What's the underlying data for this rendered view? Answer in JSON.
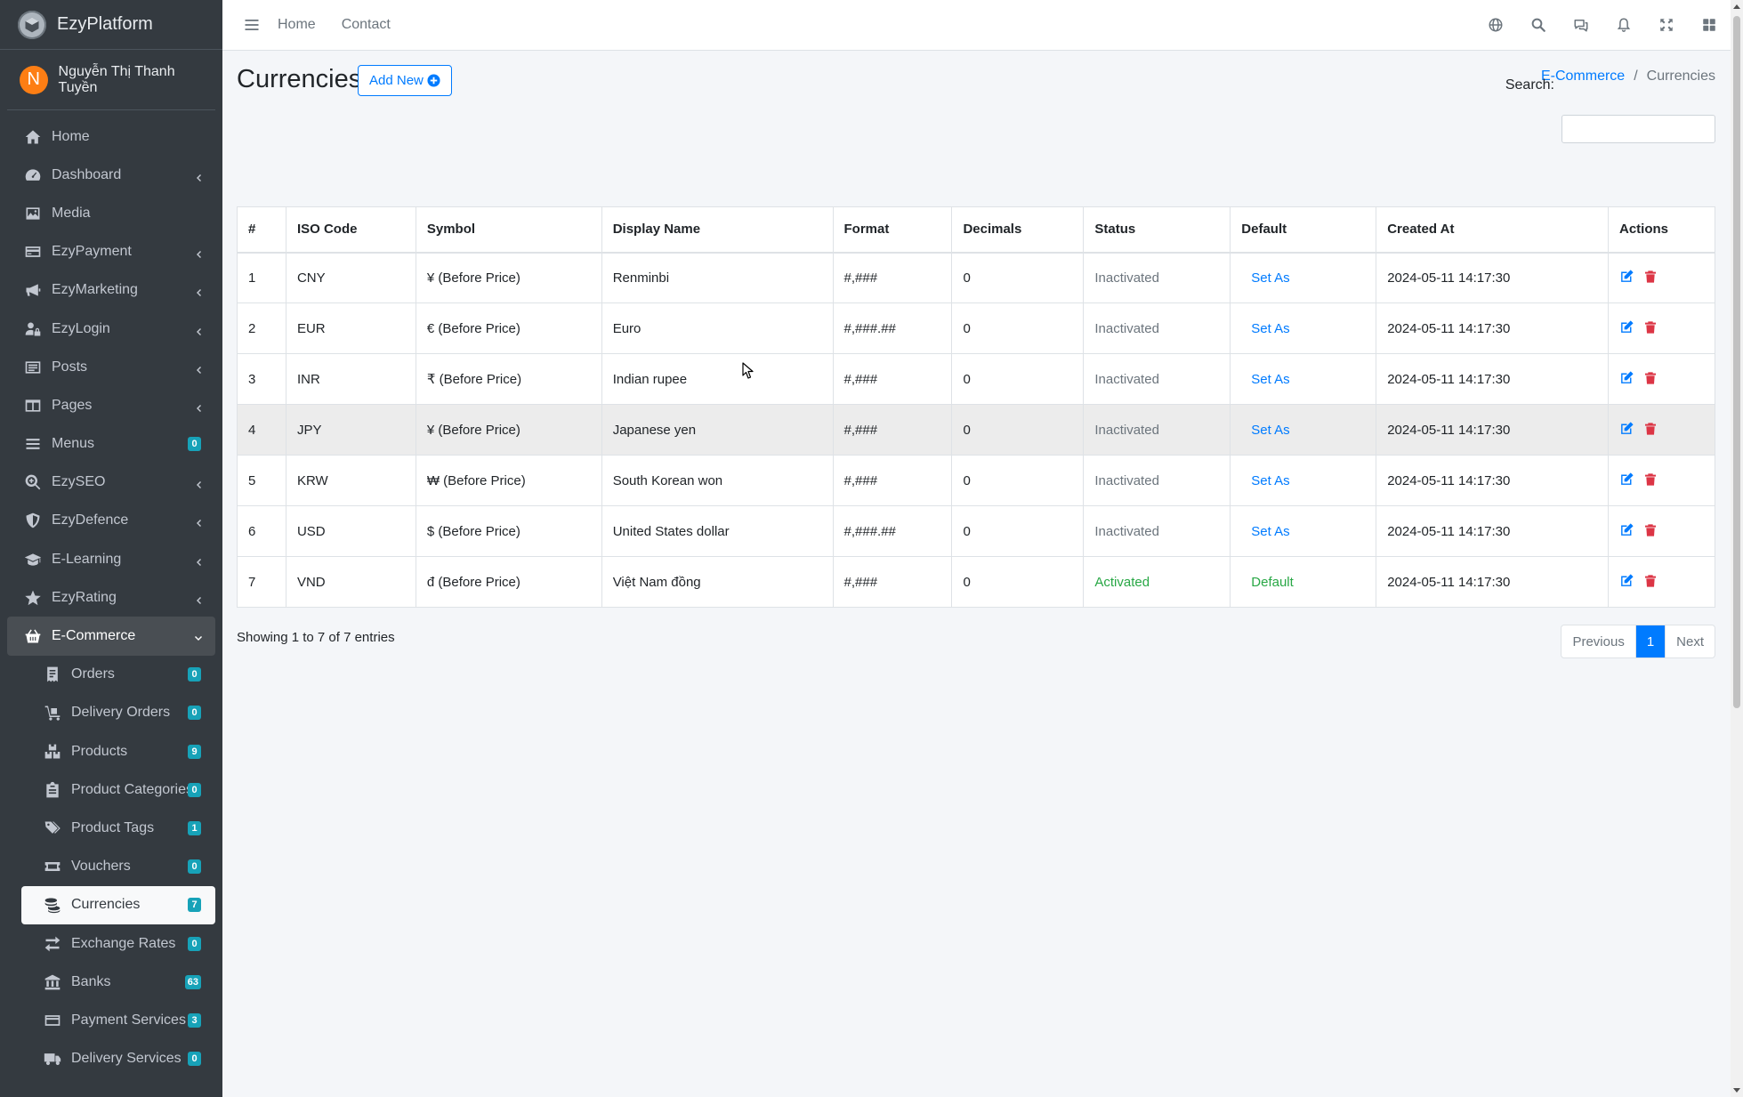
{
  "brand": {
    "name": "EzyPlatform"
  },
  "user": {
    "initial": "N",
    "name": "Nguyễn Thị Thanh Tuyền"
  },
  "sidebar": {
    "items": [
      {
        "label": "Home",
        "icon": "home-icon",
        "chevron": false
      },
      {
        "label": "Dashboard",
        "icon": "dashboard-icon",
        "chevron": true
      },
      {
        "label": "Media",
        "icon": "image-icon",
        "chevron": false
      },
      {
        "label": "EzyPayment",
        "icon": "credit-card-icon",
        "chevron": true
      },
      {
        "label": "EzyMarketing",
        "icon": "bullhorn-icon",
        "chevron": true
      },
      {
        "label": "EzyLogin",
        "icon": "user-lock-icon",
        "chevron": true
      },
      {
        "label": "Posts",
        "icon": "posts-icon",
        "chevron": true
      },
      {
        "label": "Pages",
        "icon": "pages-icon",
        "chevron": true
      },
      {
        "label": "Menus",
        "icon": "bars-icon",
        "badge": "0"
      },
      {
        "label": "EzySEO",
        "icon": "search-plus-icon",
        "chevron": true
      },
      {
        "label": "EzyDefence",
        "icon": "shield-icon",
        "chevron": true
      },
      {
        "label": "E-Learning",
        "icon": "graduation-cap-icon",
        "chevron": true
      },
      {
        "label": "EzyRating",
        "icon": "star-icon",
        "chevron": true
      }
    ],
    "ecommerce": {
      "label": "E-Commerce"
    },
    "sub_items": [
      {
        "label": "Orders",
        "badge": "0",
        "icon": "orders-icon"
      },
      {
        "label": "Delivery Orders",
        "badge": "0",
        "icon": "dolly-icon"
      },
      {
        "label": "Products",
        "badge": "9",
        "icon": "boxes-icon"
      },
      {
        "label": "Product Categories",
        "badge": "0",
        "icon": "clipboard-icon"
      },
      {
        "label": "Product Tags",
        "badge": "1",
        "icon": "tags-icon"
      },
      {
        "label": "Vouchers",
        "badge": "0",
        "icon": "ticket-icon"
      },
      {
        "label": "Currencies",
        "badge": "7",
        "icon": "coins-icon",
        "active": true
      },
      {
        "label": "Exchange Rates",
        "badge": "0",
        "icon": "exchange-icon"
      },
      {
        "label": "Banks",
        "badge": "63",
        "icon": "bank-icon"
      },
      {
        "label": "Payment Services",
        "badge": "3",
        "icon": "payment-icon"
      },
      {
        "label": "Delivery Services",
        "badge": "0",
        "icon": "truck-icon"
      }
    ]
  },
  "topbar": {
    "home": "Home",
    "contact": "Contact"
  },
  "page": {
    "title": "Currencies",
    "add_new": "Add New"
  },
  "breadcrumb": {
    "parent": "E-Commerce",
    "separator": "/",
    "current": "Currencies"
  },
  "search": {
    "label": "Search:"
  },
  "table": {
    "headers": [
      "#",
      "ISO Code",
      "Symbol",
      "Display Name",
      "Format",
      "Decimals",
      "Status",
      "Default",
      "Created At",
      "Actions"
    ],
    "rows": [
      {
        "num": "1",
        "iso": "CNY",
        "symbol": "¥ (Before Price)",
        "name": "Renminbi",
        "format": "#,###",
        "decimals": "0",
        "status": "Inactivated",
        "default": "Set As",
        "created": "2024-05-11 14:17:30"
      },
      {
        "num": "2",
        "iso": "EUR",
        "symbol": "€ (Before Price)",
        "name": "Euro",
        "format": "#,###.##",
        "decimals": "0",
        "status": "Inactivated",
        "default": "Set As",
        "created": "2024-05-11 14:17:30"
      },
      {
        "num": "3",
        "iso": "INR",
        "symbol": "₹ (Before Price)",
        "name": "Indian rupee",
        "format": "#,###",
        "decimals": "0",
        "status": "Inactivated",
        "default": "Set As",
        "created": "2024-05-11 14:17:30"
      },
      {
        "num": "4",
        "iso": "JPY",
        "symbol": "¥ (Before Price)",
        "name": "Japanese yen",
        "format": "#,###",
        "decimals": "0",
        "status": "Inactivated",
        "default": "Set As",
        "created": "2024-05-11 14:17:30"
      },
      {
        "num": "5",
        "iso": "KRW",
        "symbol": "₩ (Before Price)",
        "name": "South Korean won",
        "format": "#,###",
        "decimals": "0",
        "status": "Inactivated",
        "default": "Set As",
        "created": "2024-05-11 14:17:30"
      },
      {
        "num": "6",
        "iso": "USD",
        "symbol": "$ (Before Price)",
        "name": "United States dollar",
        "format": "#,###.##",
        "decimals": "0",
        "status": "Inactivated",
        "default": "Set As",
        "created": "2024-05-11 14:17:30"
      },
      {
        "num": "7",
        "iso": "VND",
        "symbol": "đ (Before Price)",
        "name": "Việt Nam đồng",
        "format": "#,###",
        "decimals": "0",
        "status": "Activated",
        "default": "Default",
        "created": "2024-05-11 14:17:30"
      }
    ]
  },
  "footer": {
    "info": "Showing 1 to 7 of 7 entries",
    "previous": "Previous",
    "page": "1",
    "next": "Next"
  },
  "colors": {
    "sidebar_bg": "#343a40",
    "primary": "#007bff",
    "success": "#28a745",
    "danger": "#dc3545",
    "badge": "#17a2b8",
    "avatar": "#fd7e14"
  }
}
